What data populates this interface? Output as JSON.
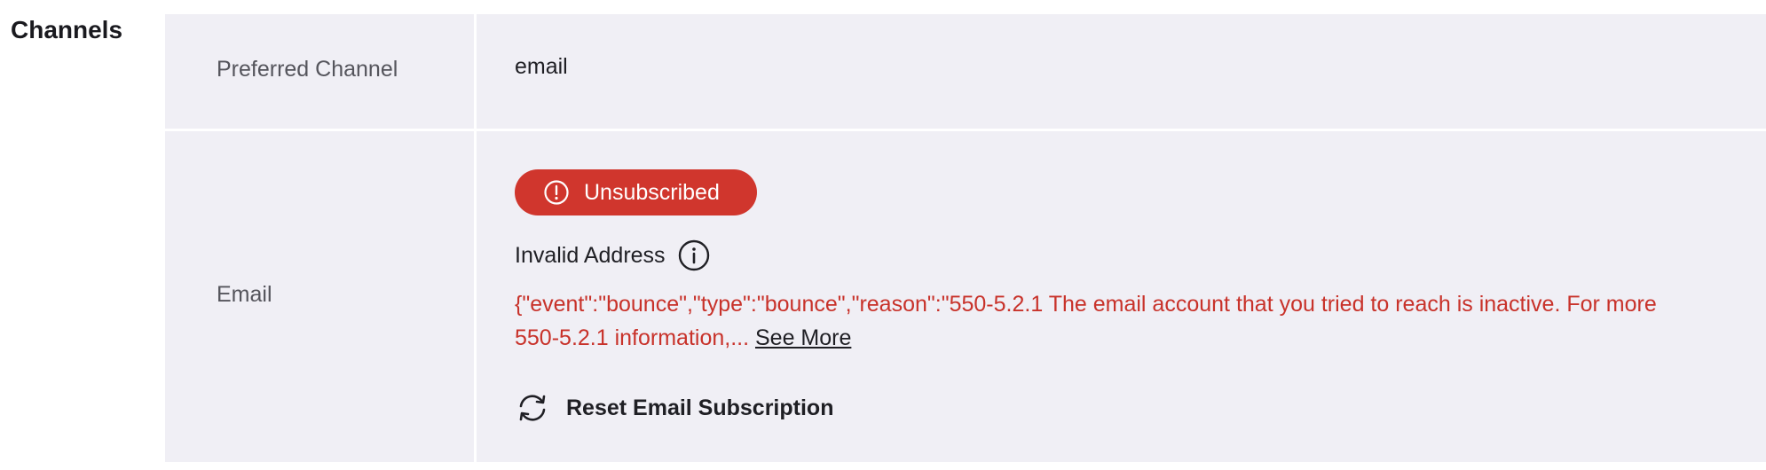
{
  "section": {
    "title": "Channels"
  },
  "rows": {
    "preferred": {
      "label": "Preferred Channel",
      "value": "email"
    },
    "email": {
      "label": "Email",
      "badge": {
        "text": "Unsubscribed",
        "icon": "alert-circle-icon",
        "color": "#d0362d"
      },
      "status": {
        "text": "Invalid Address",
        "icon": "info-icon"
      },
      "error": {
        "text": "{\"event\":\"bounce\",\"type\":\"bounce\",\"reason\":\"550-5.2.1 The email account that you tried to reach is inactive. For more 550-5.2.1 information,... ",
        "color": "#c8322a",
        "see_more": "See More"
      },
      "reset": {
        "label": "Reset Email Subscription",
        "icon": "refresh-icon"
      }
    }
  }
}
